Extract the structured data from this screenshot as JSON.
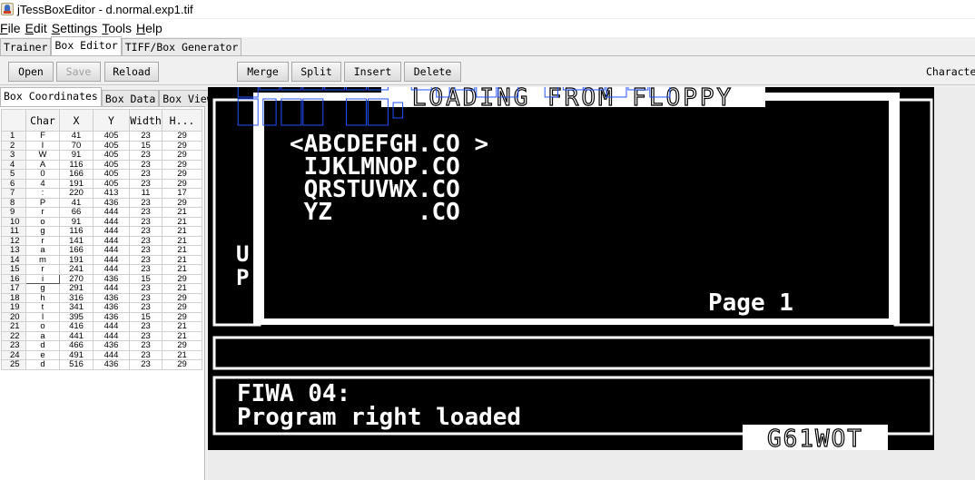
{
  "window": {
    "title": "jTessBoxEditor - d.normal.exp1.tif"
  },
  "menu": [
    "File",
    "Edit",
    "Settings",
    "Tools",
    "Help"
  ],
  "main_tabs": [
    "Trainer",
    "Box Editor",
    "TIFF/Box Generator"
  ],
  "toolbar": {
    "open": "Open",
    "save": "Save",
    "reload": "Reload",
    "merge": "Merge",
    "split": "Split",
    "insert": "Insert",
    "delete": "Delete",
    "character_label": "Character"
  },
  "side_tabs": [
    "Box Coordinates",
    "Box Data",
    "Box View"
  ],
  "table": {
    "headers": [
      "",
      "Char",
      "X",
      "Y",
      "Width",
      "H..."
    ],
    "rows": [
      [
        "1",
        "F",
        "41",
        "405",
        "23",
        "29"
      ],
      [
        "2",
        "I",
        "70",
        "405",
        "15",
        "29"
      ],
      [
        "3",
        "W",
        "91",
        "405",
        "23",
        "29"
      ],
      [
        "4",
        "A",
        "116",
        "405",
        "23",
        "29"
      ],
      [
        "5",
        "0",
        "166",
        "405",
        "23",
        "29"
      ],
      [
        "6",
        "4",
        "191",
        "405",
        "23",
        "29"
      ],
      [
        "7",
        ":",
        "220",
        "413",
        "11",
        "17"
      ],
      [
        "8",
        "P",
        "41",
        "436",
        "23",
        "29"
      ],
      [
        "9",
        "r",
        "66",
        "444",
        "23",
        "21"
      ],
      [
        "10",
        "o",
        "91",
        "444",
        "23",
        "21"
      ],
      [
        "11",
        "g",
        "116",
        "444",
        "23",
        "21"
      ],
      [
        "12",
        "r",
        "141",
        "444",
        "23",
        "21"
      ],
      [
        "13",
        "a",
        "166",
        "444",
        "23",
        "21"
      ],
      [
        "14",
        "m",
        "191",
        "444",
        "23",
        "21"
      ],
      [
        "15",
        "r",
        "241",
        "444",
        "23",
        "21"
      ],
      [
        "16",
        "i",
        "270",
        "436",
        "15",
        "29"
      ],
      [
        "17",
        "g",
        "291",
        "444",
        "23",
        "21"
      ],
      [
        "18",
        "h",
        "316",
        "436",
        "23",
        "29"
      ],
      [
        "19",
        "t",
        "341",
        "436",
        "23",
        "29"
      ],
      [
        "20",
        "l",
        "395",
        "436",
        "15",
        "29"
      ],
      [
        "21",
        "o",
        "416",
        "444",
        "23",
        "21"
      ],
      [
        "22",
        "a",
        "441",
        "444",
        "23",
        "21"
      ],
      [
        "23",
        "d",
        "466",
        "436",
        "23",
        "29"
      ],
      [
        "24",
        "e",
        "491",
        "444",
        "23",
        "21"
      ],
      [
        "25",
        "d",
        "516",
        "436",
        "23",
        "29"
      ]
    ]
  },
  "image": {
    "header": "LOADING FROM FLOPPY",
    "lines": [
      "<ABCDEFGH.CO >",
      " IJKLMNOP.CO",
      " QRSTUVWX.CO",
      " YZ      .CO"
    ],
    "page_label": "Page 1",
    "side_letters": [
      "U",
      "P"
    ],
    "status_line1": "FIWA 04:",
    "status_line2": "Program right loaded",
    "footer": "G61WOT"
  },
  "colors": {
    "screen": "#000000",
    "text": "#ffffff",
    "box_outline": "#2050ff",
    "selected_row": "#505050"
  }
}
